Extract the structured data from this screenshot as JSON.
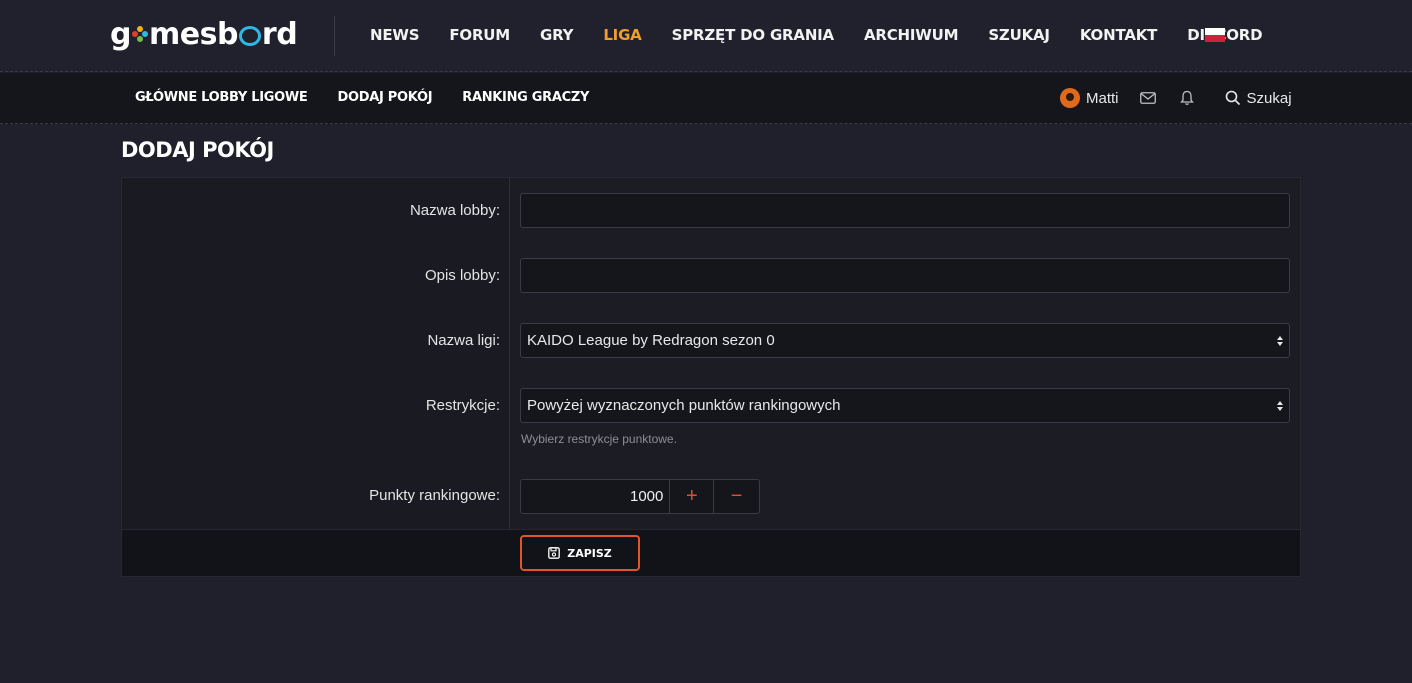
{
  "header": {
    "logo": {
      "part1": "g",
      "part2": "mesb",
      "part3": "rd"
    },
    "nav": [
      "NEWS",
      "FORUM",
      "GRY",
      "LIGA",
      "SPRZĘT DO GRANIA",
      "ARCHIWUM",
      "SZUKAJ",
      "KONTAKT",
      "DISCORD"
    ],
    "active_nav": "LIGA",
    "language_flag": "flag-pl-icon"
  },
  "subnav": {
    "items": [
      "GŁÓWNE LOBBY LIGOWE",
      "DODAJ POKÓJ",
      "RANKING GRACZY"
    ],
    "user_name": "Matti",
    "search_label": "Szukaj"
  },
  "page": {
    "title": "DODAJ POKÓJ"
  },
  "form": {
    "lobby_name": {
      "label": "Nazwa lobby:",
      "value": ""
    },
    "lobby_desc": {
      "label": "Opis lobby:",
      "value": ""
    },
    "league": {
      "label": "Nazwa ligi:",
      "value": "KAIDO League by Redragon sezon 0"
    },
    "restrictions": {
      "label": "Restrykcje:",
      "value": "Powyżej wyznaczonych punktów rankingowych",
      "hint": "Wybierz restrykcje punktowe."
    },
    "points": {
      "label": "Punkty rankingowe:",
      "value": "1000",
      "plus": "+",
      "minus": "−"
    },
    "save_label": "ZAPISZ"
  },
  "colors": {
    "accent": "#f0a02a",
    "button_border": "#e0552a",
    "background": "#1f202b"
  }
}
